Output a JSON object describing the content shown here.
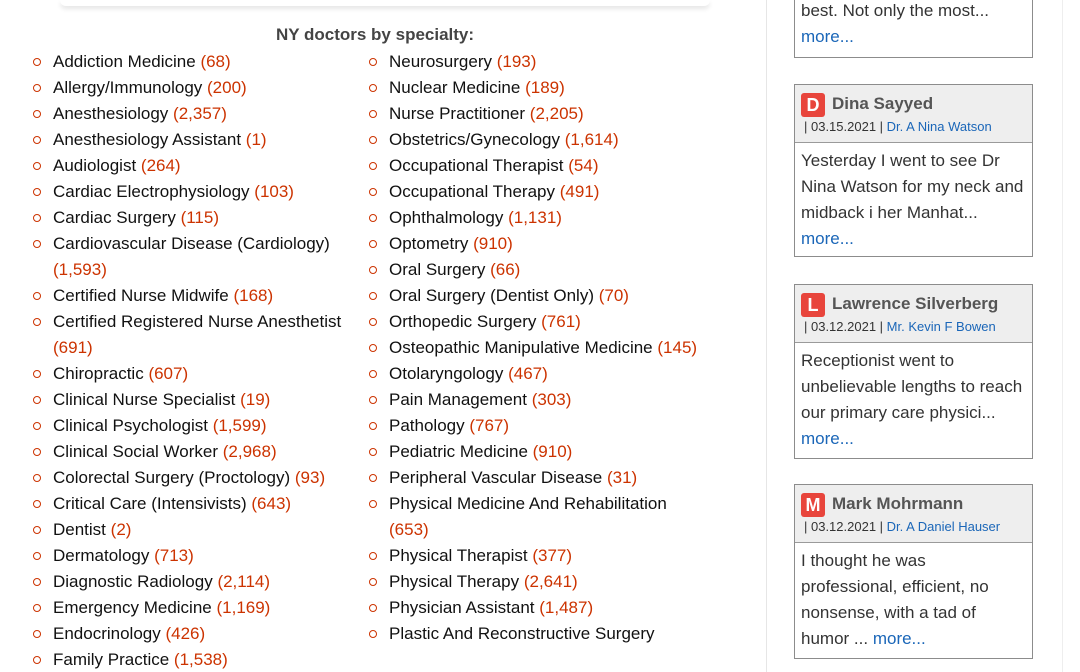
{
  "specialties": {
    "heading": "NY doctors by specialty:",
    "left": [
      {
        "name": "Addiction Medicine",
        "count": "(68)"
      },
      {
        "name": "Allergy/Immunology",
        "count": "(200)"
      },
      {
        "name": "Anesthesiology",
        "count": "(2,357)"
      },
      {
        "name": "Anesthesiology Assistant",
        "count": "(1)"
      },
      {
        "name": "Audiologist",
        "count": "(264)"
      },
      {
        "name": "Cardiac Electrophysiology",
        "count": "(103)"
      },
      {
        "name": "Cardiac Surgery",
        "count": "(115)"
      },
      {
        "name": "Cardiovascular Disease (Cardiology)",
        "count": "(1,593)"
      },
      {
        "name": "Certified Nurse Midwife",
        "count": "(168)"
      },
      {
        "name": "Certified Registered Nurse Anesthetist",
        "count": "(691)"
      },
      {
        "name": "Chiropractic",
        "count": "(607)"
      },
      {
        "name": "Clinical Nurse Specialist",
        "count": "(19)"
      },
      {
        "name": "Clinical Psychologist",
        "count": "(1,599)"
      },
      {
        "name": "Clinical Social Worker",
        "count": "(2,968)"
      },
      {
        "name": "Colorectal Surgery (Proctology)",
        "count": "(93)"
      },
      {
        "name": "Critical Care (Intensivists)",
        "count": "(643)"
      },
      {
        "name": "Dentist",
        "count": "(2)"
      },
      {
        "name": "Dermatology",
        "count": "(713)"
      },
      {
        "name": "Diagnostic Radiology",
        "count": "(2,114)"
      },
      {
        "name": "Emergency Medicine",
        "count": "(1,169)"
      },
      {
        "name": "Endocrinology",
        "count": "(426)"
      },
      {
        "name": "Family Practice",
        "count": "(1,538)"
      }
    ],
    "right": [
      {
        "name": "Neurosurgery",
        "count": "(193)"
      },
      {
        "name": "Nuclear Medicine",
        "count": "(189)"
      },
      {
        "name": "Nurse Practitioner",
        "count": "(2,205)"
      },
      {
        "name": "Obstetrics/Gynecology",
        "count": "(1,614)"
      },
      {
        "name": "Occupational Therapist",
        "count": "(54)"
      },
      {
        "name": "Occupational Therapy",
        "count": "(491)"
      },
      {
        "name": "Ophthalmology",
        "count": "(1,131)"
      },
      {
        "name": "Optometry",
        "count": "(910)"
      },
      {
        "name": "Oral Surgery",
        "count": "(66)"
      },
      {
        "name": "Oral Surgery (Dentist Only)",
        "count": "(70)"
      },
      {
        "name": "Orthopedic Surgery",
        "count": "(761)"
      },
      {
        "name": "Osteopathic Manipulative Medicine",
        "count": "(145)"
      },
      {
        "name": "Otolaryngology",
        "count": "(467)"
      },
      {
        "name": "Pain Management",
        "count": "(303)"
      },
      {
        "name": "Pathology",
        "count": "(767)"
      },
      {
        "name": "Pediatric Medicine",
        "count": "(910)"
      },
      {
        "name": "Peripheral Vascular Disease",
        "count": "(31)"
      },
      {
        "name": "Physical Medicine And Rehabilitation",
        "count": "(653)"
      },
      {
        "name": "Physical Therapist",
        "count": "(377)"
      },
      {
        "name": "Physical Therapy",
        "count": "(2,641)"
      },
      {
        "name": "Physician Assistant",
        "count": "(1,487)"
      },
      {
        "name": "Plastic And Reconstructive Surgery",
        "count": ""
      }
    ]
  },
  "reviews": {
    "partial": {
      "text": "best. Not only the most...",
      "more": "more..."
    },
    "items": [
      {
        "initial": "D",
        "reviewer": "Dina Sayyed",
        "date": "| 03.15.2021 |",
        "doctor": "Dr. A Nina Watson",
        "text": "Yesterday I went to see Dr Nina Watson for my neck and midback i her Manhat...",
        "more": "more..."
      },
      {
        "initial": "L",
        "reviewer": "Lawrence Silverberg",
        "date": "| 03.12.2021 |",
        "doctor": "Mr. Kevin F Bowen",
        "text": "Receptionist went to unbelievable lengths to reach our primary care physici...",
        "more": "more..."
      },
      {
        "initial": "M",
        "reviewer": "Mark Mohrmann",
        "date": "| 03.12.2021 |",
        "doctor": "Dr. A Daniel Hauser",
        "text": "I thought he was professional, efficient, no nonsense, with a tad of humor ...",
        "more": "more..."
      }
    ]
  },
  "colors": {
    "count": "#cc3300",
    "link": "#1a66b8",
    "avatar": "#e8453c"
  }
}
